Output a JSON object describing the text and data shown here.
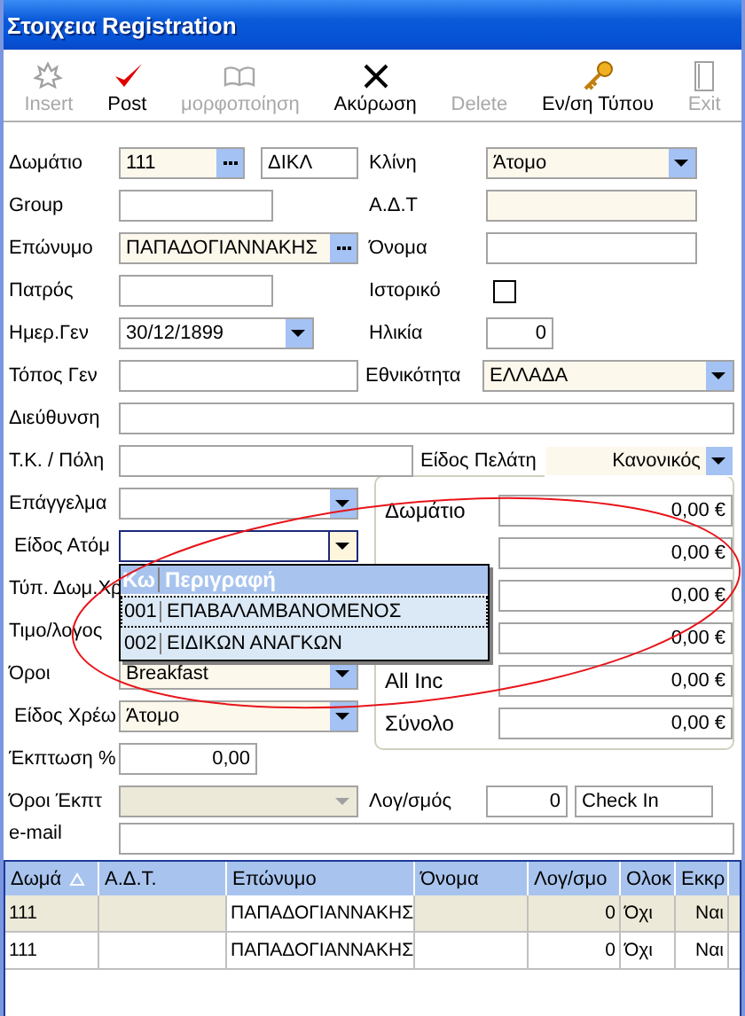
{
  "window": {
    "title": "Στοιχεια Registration"
  },
  "toolbar": [
    {
      "label": "Insert",
      "disabled": true
    },
    {
      "label": "Post",
      "disabled": false
    },
    {
      "label": "μορφοποίηση",
      "disabled": true
    },
    {
      "label": "Ακύρωση",
      "disabled": false
    },
    {
      "label": "Delete",
      "disabled": true
    },
    {
      "label": "Εν/ση Τύπου",
      "disabled": false
    },
    {
      "label": "Exit",
      "disabled": true
    }
  ],
  "form": {
    "room": {
      "label": "Δωμάτιο",
      "value": "111",
      "code": "ΔΙΚΛ"
    },
    "bed": {
      "label": "Κλίνη",
      "value": "Άτομο"
    },
    "group": {
      "label": "Group"
    },
    "id_card": {
      "label": "Α.Δ.Τ"
    },
    "surname": {
      "label": "Επώνυμο",
      "value": "ΠΑΠΑΔΟΓΙΑΝΝΑΚΗΣ"
    },
    "first_name": {
      "label": "Όνομα"
    },
    "father": {
      "label": "Πατρός"
    },
    "history": {
      "label": "Ιστορικό",
      "checked": false
    },
    "birth_date": {
      "label": "Ημερ.Γεν",
      "value": "30/12/1899"
    },
    "age": {
      "label": "Ηλικία",
      "value": "0"
    },
    "birth_place": {
      "label": "Τόπος Γεν"
    },
    "nationality": {
      "label": "Εθνικότητα",
      "value": "ΕΛΛΑΔΑ"
    },
    "address": {
      "label": "Διεύθυνση"
    },
    "postcode_city": {
      "label": "Τ.Κ. / Πόλη"
    },
    "customer_type": {
      "label": "Είδος Πελάτη",
      "value": "Κανονικός"
    },
    "profession": {
      "label": "Επάγγελμα"
    },
    "person_type": {
      "label": "Είδος Ατόμ",
      "focused": true
    },
    "room_type": {
      "label": "Τύπ. Δωμ.Χρ"
    },
    "rate": {
      "label": "Τιμο/λογος"
    },
    "terms": {
      "label": "Όροι",
      "value": "Breakfast"
    },
    "charge_type": {
      "label": "Είδος Χρέω",
      "value": "Άτομο"
    },
    "discount": {
      "label": "Έκπτωση %",
      "value": "0,00"
    },
    "discount_terms": {
      "label": "Όροι Έκπτ",
      "disabled": true
    },
    "account": {
      "label": "Λογ/σμός",
      "value": "0",
      "status": "Check In"
    },
    "email": {
      "label": "e-mail"
    }
  },
  "prices": [
    {
      "label": "Δωμάτιο",
      "value": "0,00 €"
    },
    {
      "value": "0,00 €"
    },
    {
      "value": "0,00 €"
    },
    {
      "value": "0,00 €"
    },
    {
      "label": "All Inc",
      "value": "0,00 €"
    },
    {
      "label": "Σύνολο",
      "value": "0,00 €"
    }
  ],
  "dropdown": {
    "columns": [
      "Κω",
      "Περιγραφή"
    ],
    "rows": [
      {
        "code": "001",
        "description": "ΕΠΑΒΑΛΑΜΒΑΝΟΜΕΝΟΣ",
        "selected": true
      },
      {
        "code": "002",
        "description": "ΕΙΔΙΚΩΝ ΑΝΑΓΚΩΝ",
        "selected": false
      }
    ]
  },
  "grid": {
    "columns": [
      {
        "label": "Δωμά",
        "sorted": true
      },
      {
        "label": "Α.Δ.Τ."
      },
      {
        "label": "Επώνυμο"
      },
      {
        "label": "Όνομα"
      },
      {
        "label": "Λογ/σμο"
      },
      {
        "label": "Ολοκ"
      },
      {
        "label": "Εκκρ"
      }
    ],
    "rows": [
      {
        "room": "111",
        "surname": "ΠΑΠΑΔΟΓΙΑΝΝΑΚΗΣ",
        "account": "0",
        "completed": "Όχι",
        "pending": "Ναι",
        "selected": true
      },
      {
        "room": "111",
        "surname": "ΠΑΠΑΔΟΓΙΑΝΝΑΚΗΣ",
        "account": "0",
        "completed": "Όχι",
        "pending": "Ναι",
        "selected": false
      }
    ]
  },
  "annotation": {
    "kind": "ellipse",
    "color": "#e8141a"
  }
}
